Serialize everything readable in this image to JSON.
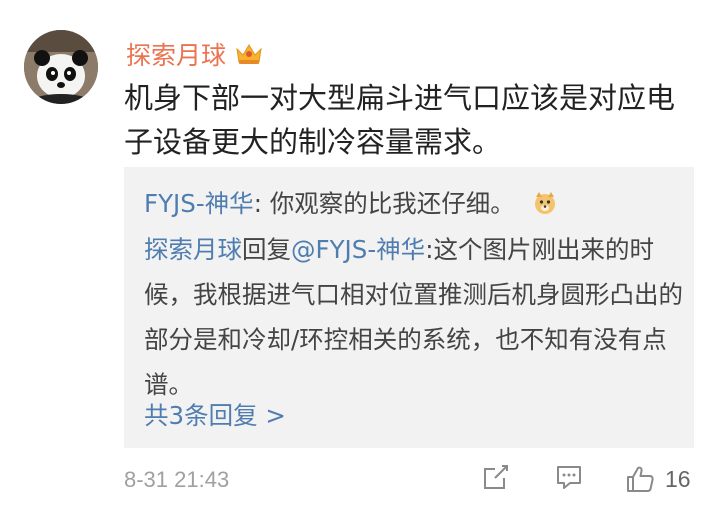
{
  "comment": {
    "username": "探索月球",
    "text": "机身下部一对大型扁斗进气口应该是对应电子设备更大的制冷容量需求。",
    "timestamp": "8-31 21:43",
    "like_count": "16"
  },
  "replies": [
    {
      "author": "FYJS-神华",
      "separator": ":",
      "text": " 你观察的比我还仔细。",
      "emoji": "doge-emoji"
    },
    {
      "author": "探索月球",
      "reply_word": "回复",
      "mention": "@FYJS-神华",
      "separator": ":",
      "text": "这个图片刚出来的时候，我根据进气口相对位置推测后机身圆形凸出的部分是和冷却/环控相关的系统，也不知有没有点谱。"
    }
  ],
  "more_replies_label": "共3条回复 >",
  "colors": {
    "username": "#eb7350",
    "link": "#507daf",
    "reply_bg": "#f2f2f2",
    "meta": "#a0a0a0"
  },
  "icons": {
    "vip": "crown-badge-icon",
    "share": "share-icon",
    "comment": "comment-icon",
    "like": "thumbs-up-icon"
  }
}
